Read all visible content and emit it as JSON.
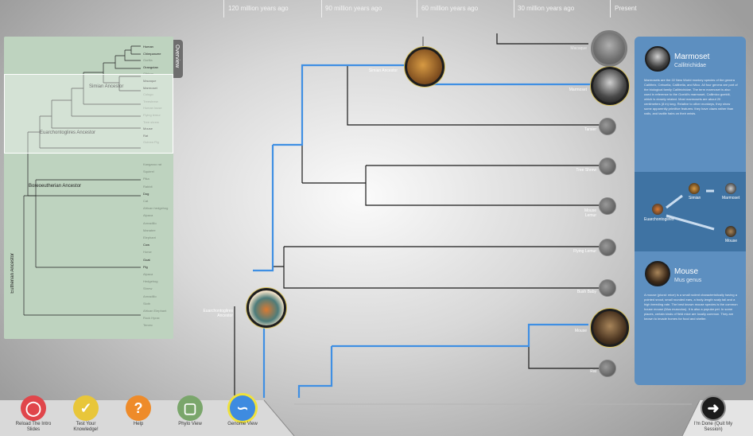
{
  "timeline": {
    "labels": [
      "120 million years ago",
      "90 million years ago",
      "60 million years ago",
      "30 million years ago",
      "Present"
    ]
  },
  "overview": {
    "tab_label": "Overview",
    "items_top": [
      "Human",
      "Chimpanzee",
      "Gorilla",
      "Orangutan",
      "Gibbon",
      "Macaque",
      "Marmoset",
      "Colugo",
      "Treeshrew",
      "Human louse",
      "Flying lemur",
      "Tree shrew",
      "Mouse",
      "Rat",
      "Guinea Pig"
    ],
    "items_bottom": [
      "Kangaroo rat",
      "Squirrel",
      "Pika",
      "Rabbit",
      "Dog",
      "Cat",
      "African hedgehog",
      "Alpaca",
      "Armadillo",
      "Manatee",
      "Elephant",
      "Cow",
      "Horse",
      "Goat",
      "Pig",
      "Alpaca",
      "Hedgehog",
      "Shrew",
      "Armadillo",
      "Sloth",
      "African Elephant",
      "Rock Hyrax",
      "Tenrec"
    ],
    "ancestors": [
      "Simian Ancestor",
      "Euarchontoglires Ancestor",
      "Boreoeutherian Ancestor",
      "Eutherian Ancestor"
    ]
  },
  "tree": {
    "leaves": [
      "Macaque",
      "Marmoset",
      "Tarsier",
      "Tree Shrew",
      "Mouse Lemur",
      "Flying Lemur",
      "Bush Baby",
      "Mouse",
      "Rat"
    ],
    "internal": [
      "Simian Ancestor",
      "Euarchontoglires Ancestor"
    ],
    "highlight_color": "#3f8fe3"
  },
  "panel": {
    "card1": {
      "title": "Marmoset",
      "subtitle": "Callitrichidae",
      "text": "Marmosets are the 22 New World monkey species of the genera Callithrix, Cebuella, Callibella, and Mico. All four genera are part of the biological family Callitrichidae. The term marmoset is also used in reference to the Goeldi's marmoset, Callimico goeldii, which is closely related. Most marmosets are about 20 centimeters (8 in) long. Relative to other monkeys, they show some apparently primitive features: they have claws rather than nails, and tactile hairs on their wrists."
    },
    "ancestry": {
      "start": "Euarchontoglires",
      "middle": "Simian",
      "end1": "Marmoset",
      "end2": "Mouse"
    },
    "card2": {
      "title": "Mouse",
      "subtitle": "Mus genus",
      "text": "A mouse (plural: mice) is a small rodent characteristically having a pointed snout, small rounded ears, a body-length scaly tail and a high breeding rate. The best known mouse species is the common house mouse (Mus musculus). It is also a popular pet. In some places, certain kinds of field mice are locally common. They are known to invade homes for food and shelter."
    }
  },
  "toolbar": {
    "buttons": [
      {
        "label": "Reload The Intro Slides",
        "color": "#e0464b"
      },
      {
        "label": "Test Your Knowledge!",
        "color": "#e8c63a"
      },
      {
        "label": "Help",
        "color": "#ee8b2a"
      },
      {
        "label": "Phylo View",
        "color": "#7aa66b"
      },
      {
        "label": "Genome View",
        "color": "#3e8be0"
      }
    ],
    "done": "I'm Done (Quit My Session)"
  }
}
